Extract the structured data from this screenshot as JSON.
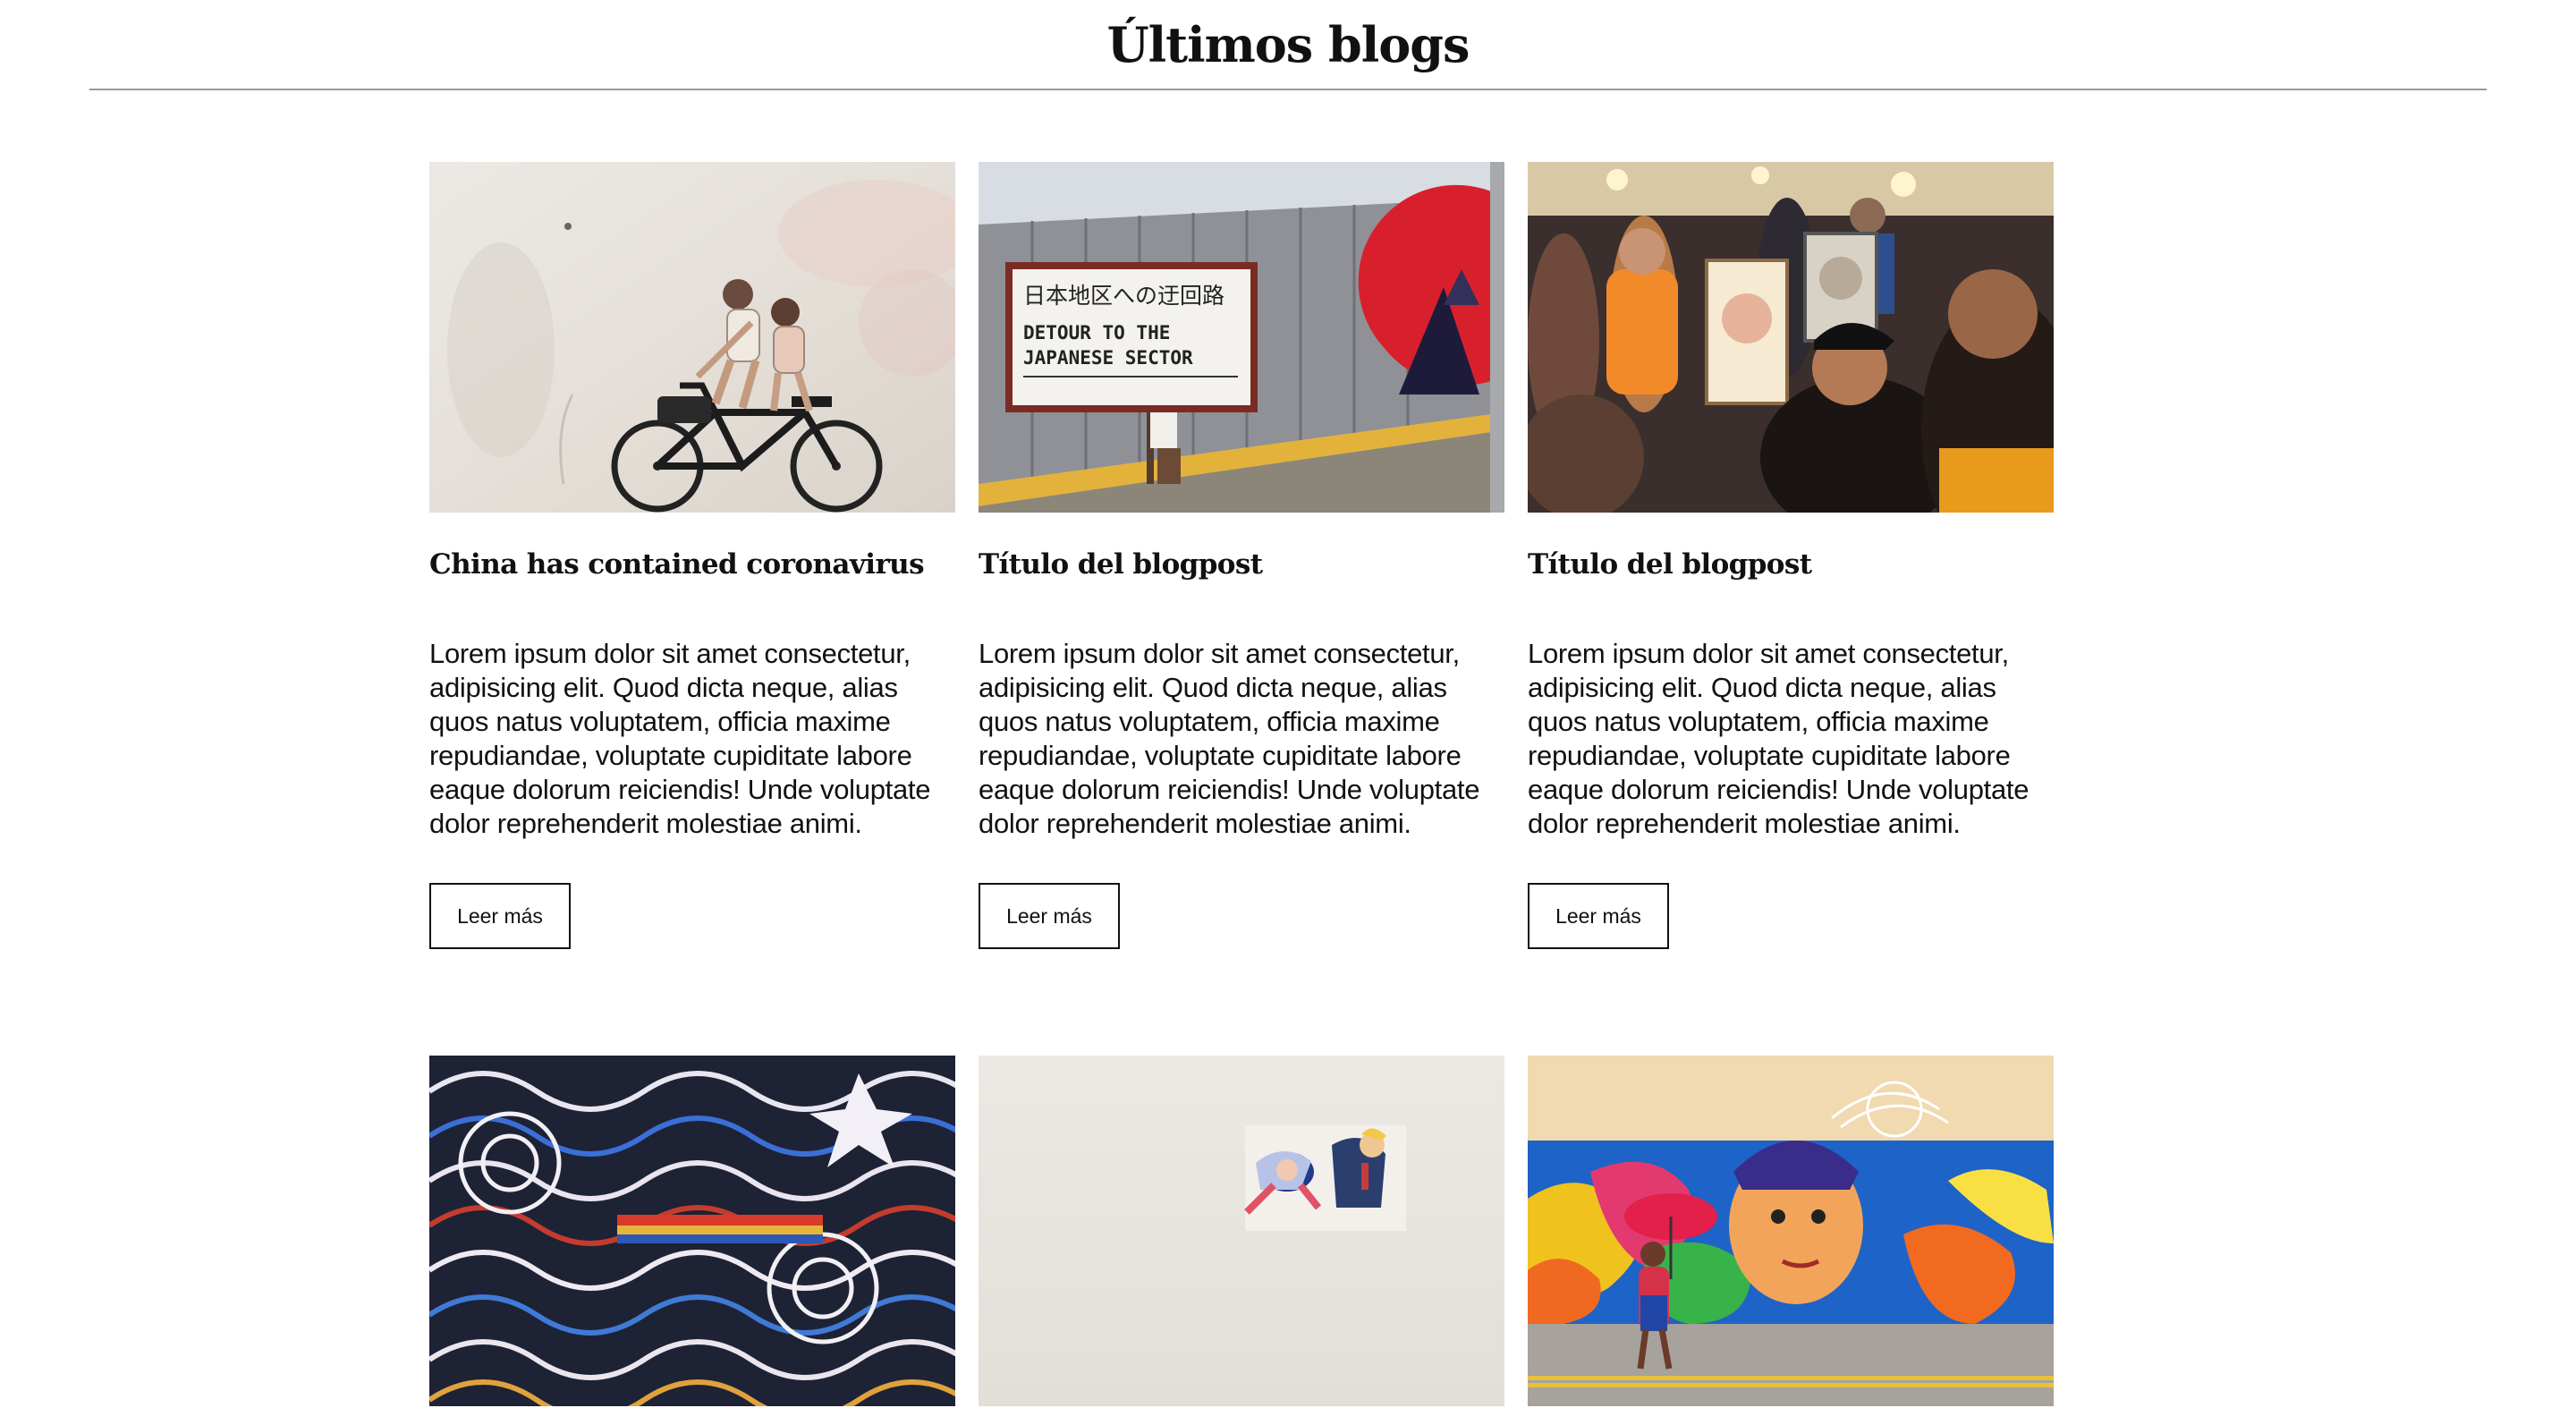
{
  "page": {
    "title": "Últimos blogs"
  },
  "posts": [
    {
      "image_icon": "image-bicycle-mural",
      "title": "China has contained coronavirus",
      "body": "Lorem ipsum dolor sit amet consectetur, adipisicing elit. Quod dicta neque, alias quos natus voluptatem, officia maxime repudiandae, voluptate cupiditate labore eaque dolorum reiciendis! Unde voluptate dolor reprehenderit molestiae animi.",
      "button_label": "Leer más"
    },
    {
      "image_icon": "image-detour-wall",
      "image_sign_line1": "日本地区への迂回路",
      "image_sign_line2": "DETOUR   TO   THE",
      "image_sign_line3": "JAPANESE   SECTOR",
      "title": "Título del blogpost",
      "body": "Lorem ipsum dolor sit amet consectetur, adipisicing elit. Quod dicta neque, alias quos natus voluptatem, officia maxime repudiandae, voluptate cupiditate labore eaque dolorum reiciendis! Unde voluptate dolor reprehenderit molestiae animi.",
      "button_label": "Leer más"
    },
    {
      "image_icon": "image-street-artist",
      "title": "Título del blogpost",
      "body": "Lorem ipsum dolor sit amet consectetur, adipisicing elit. Quod dicta neque, alias quos natus voluptatem, officia maxime repudiandae, voluptate cupiditate labore eaque dolorum reiciendis! Unde voluptate dolor reprehenderit molestiae animi.",
      "button_label": "Leer más"
    },
    {
      "image_icon": "image-psychedelic-mural"
    },
    {
      "image_icon": "image-sticker-wall"
    },
    {
      "image_icon": "image-colorful-mural"
    }
  ]
}
